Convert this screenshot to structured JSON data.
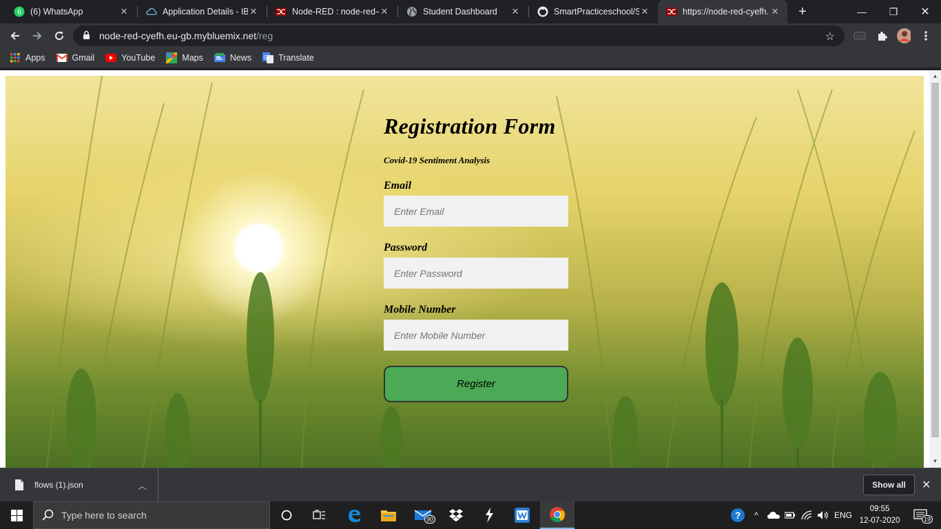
{
  "browser": {
    "tabs": [
      {
        "title": "(6) WhatsApp",
        "icon": "whatsapp-icon"
      },
      {
        "title": "Application Details - IBM",
        "icon": "ibm-cloud-icon"
      },
      {
        "title": "Node-RED : node-red-cyefh",
        "icon": "node-red-icon"
      },
      {
        "title": "Student Dashboard",
        "icon": "globe-icon"
      },
      {
        "title": "SmartPracticeschool/SB",
        "icon": "github-icon"
      },
      {
        "title": "https://node-red-cyefh.",
        "icon": "node-red-icon",
        "active": true
      }
    ],
    "address": {
      "host": "node-red-cyefh.eu-gb.mybluemix.net",
      "path": "/reg"
    },
    "bookmarks": [
      {
        "label": "Apps",
        "icon": "apps-grid-icon"
      },
      {
        "label": "Gmail",
        "icon": "gmail-icon"
      },
      {
        "label": "YouTube",
        "icon": "youtube-icon"
      },
      {
        "label": "Maps",
        "icon": "maps-icon"
      },
      {
        "label": "News",
        "icon": "news-icon"
      },
      {
        "label": "Translate",
        "icon": "translate-icon"
      }
    ]
  },
  "form": {
    "title": "Registration Form",
    "subtitle": "Covid-19 Sentiment Analysis",
    "email_label": "Email",
    "email_placeholder": "Enter Email",
    "password_label": "Password",
    "password_placeholder": "Enter Password",
    "mobile_label": "Mobile Number",
    "mobile_placeholder": "Enter Mobile Number",
    "register_label": "Register",
    "button_color": "#4caa56"
  },
  "downloads": {
    "file_name": "flows (1).json",
    "show_all_label": "Show all"
  },
  "taskbar": {
    "search_placeholder": "Type here to search",
    "mail_badge": "90",
    "language": "ENG",
    "time": "09:55",
    "date": "12-07-2020",
    "notifications": "19"
  }
}
